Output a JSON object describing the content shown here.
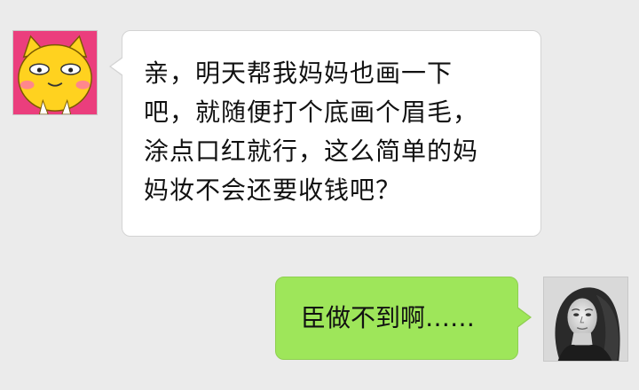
{
  "chat": {
    "messages": [
      {
        "side": "left",
        "sender_avatar": "cartoon-cat-avatar",
        "text": "亲，明天帮我妈妈也画一下\n吧，就随便打个底画个眉毛，\n涂点口红就行，这么简单的妈\n妈妆不会还要收钱吧？"
      },
      {
        "side": "right",
        "sender_avatar": "woman-portrait-avatar",
        "text": "臣做不到啊……"
      }
    ]
  },
  "colors": {
    "background": "#ebebeb",
    "incoming_bubble": "#ffffff",
    "outgoing_bubble": "#9ee65a"
  }
}
